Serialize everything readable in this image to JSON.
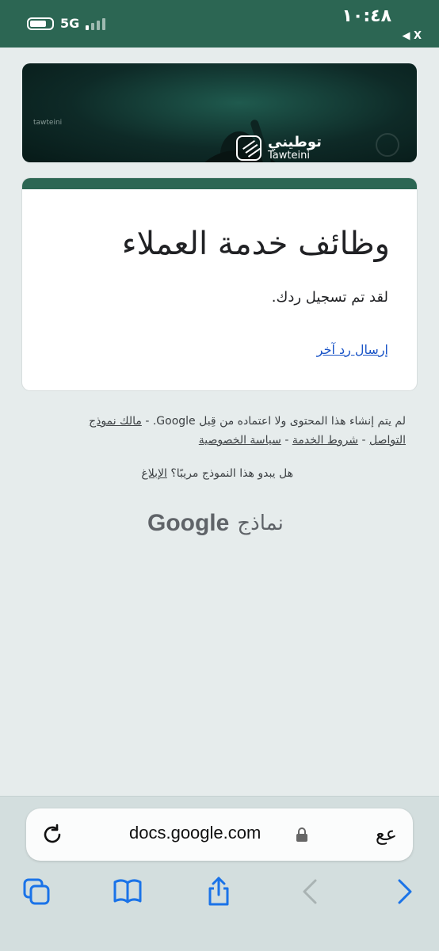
{
  "status_bar": {
    "time": "١٠:٤٨",
    "network": "5G",
    "back_label": "X"
  },
  "banner": {
    "brand_ar": "توطيني",
    "brand_en": "Tawteini",
    "small_text": "tawteini"
  },
  "form": {
    "title": "وظائف خدمة العملاء",
    "message": "لقد تم تسجيل ردك.",
    "another_response_link": "إرسال رد آخر",
    "accent_color": "#2c6653"
  },
  "footer": {
    "disclaimer_text": "لم يتم إنشاء هذا المحتوى ولا اعتماده من قِبل Google. -",
    "owner_link": "مالك نموذج التواصل",
    "separator1": "-",
    "terms_link": "شروط الخدمة",
    "separator2": "-",
    "privacy_link": "سياسة الخصوصية",
    "suspicious_text": "هل يبدو هذا النموذج مريبًا؟",
    "report_link": "الإبلاغ",
    "brand_google": "Google",
    "brand_forms_ar": "نماذج"
  },
  "browser": {
    "url": "docs.google.com",
    "text_size_button": "عع",
    "icons": [
      "tabs-icon",
      "bookmarks-icon",
      "share-icon",
      "back-icon",
      "forward-icon"
    ]
  }
}
